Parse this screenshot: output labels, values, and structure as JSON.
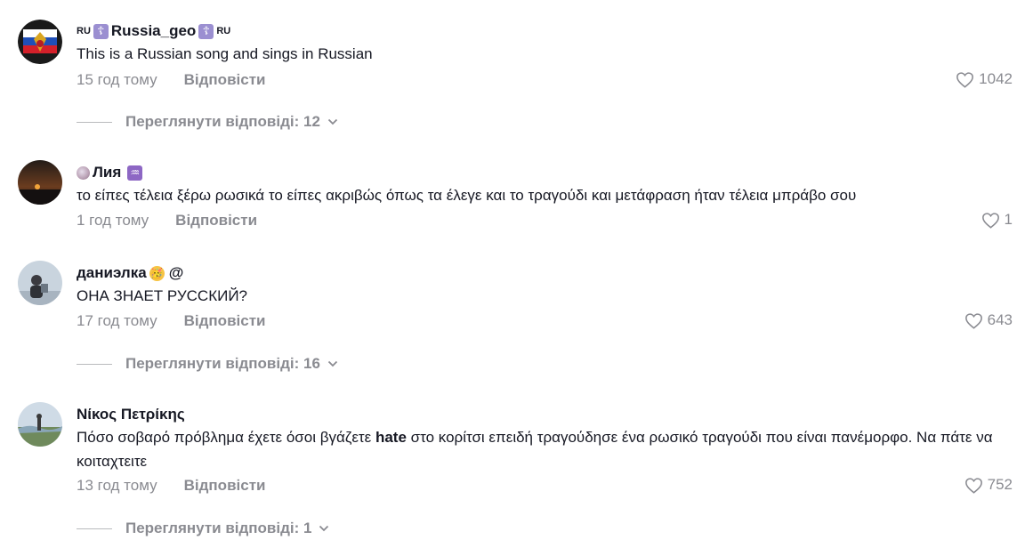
{
  "comments": [
    {
      "flag_prefix": "RU",
      "username": "Russia_geo",
      "flag_suffix": "RU",
      "text": "This is a Russian song and sings in Russian",
      "time": "15 год тому",
      "reply_label": "Відповісти",
      "likes": "1042",
      "replies_label": "Переглянути відповіді: 12"
    },
    {
      "username": "Лия",
      "text": "το είπες τέλεια ξέρω ρωσικά το είπες ακριβώς όπως τα έλεγε και το τραγούδι και μετάφραση ήταν τέλεια μπράβο σου",
      "time": "1 год тому",
      "reply_label": "Відповісти",
      "likes": "1"
    },
    {
      "username": "даниэлка",
      "username_suffix": "@",
      "text": "ОНА ЗНАЕТ РУССКИЙ?",
      "time": "17 год тому",
      "reply_label": "Відповісти",
      "likes": "643",
      "replies_label": "Переглянути відповіді: 16"
    },
    {
      "username": "Νίκος Πετρίκης",
      "text_before": "Πόσο σοβαρό πρόβλημα έχετε όσοι βγάζετε ",
      "text_bold": "hate",
      "text_after": " στο κορίτσι επειδή τραγούδησε ένα ρωσικό τραγούδι που είναι πανέμορφο. Να πάτε να κοιταχτειτε",
      "time": "13 год тому",
      "reply_label": "Відповісти",
      "likes": "752",
      "replies_label": "Переглянути відповіді: 1"
    }
  ],
  "icons": {
    "like": "heart-outline-icon",
    "expand": "chevron-down-icon",
    "badge": "orthodox-cross-icon"
  },
  "colors": {
    "text": "#161823",
    "muted": "#8a8b91"
  }
}
